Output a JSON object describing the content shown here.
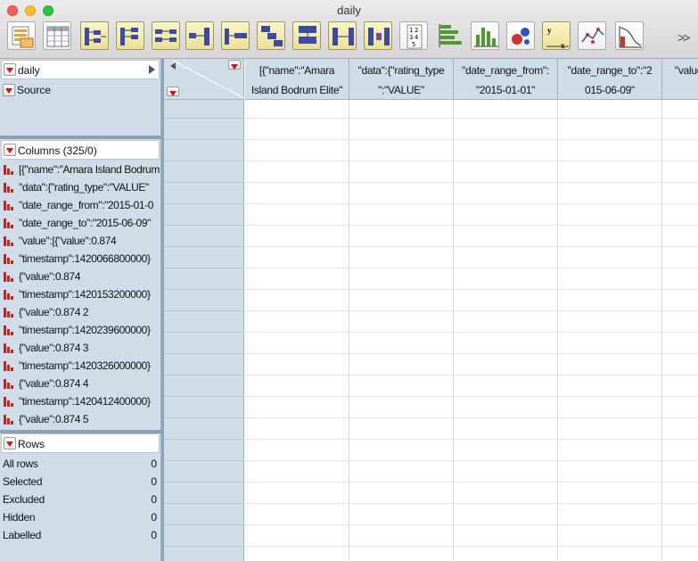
{
  "window": {
    "title": "daily"
  },
  "toolbar": {
    "tools": [
      "data-table-icon",
      "tabulate-icon",
      "summary-icon",
      "subset-icon",
      "sort-icon",
      "stack-icon",
      "split-icon",
      "transpose-icon",
      "concatenate-icon",
      "join-icon",
      "update-icon",
      "column-info-icon",
      "bar-chart-icon",
      "distribution-icon",
      "bubble-plot-icon",
      "fit-y-by-x-icon",
      "graph-builder-icon",
      "survival-icon"
    ],
    "more_label": ">>"
  },
  "tables_panel": {
    "table_name": "daily",
    "source_label": "Source"
  },
  "columns_panel": {
    "header": "Columns (325/0)",
    "items": [
      "[{\"name\":\"Amara Island Bodrum",
      "\"data\":{\"rating_type\":\"VALUE\"",
      "\"date_range_from\":\"2015-01-0",
      "\"date_range_to\":\"2015-06-09\"",
      "\"value\":[{\"value\":0.874",
      "\"timestamp\":1420066800000}",
      "{\"value\":0.874",
      "\"timestamp\":1420153200000}",
      "{\"value\":0.874 2",
      "\"timestamp\":1420239600000}",
      "{\"value\":0.874 3",
      "\"timestamp\":1420326000000}",
      "{\"value\":0.874 4",
      "\"timestamp\":1420412400000}",
      "{\"value\":0.874 5"
    ]
  },
  "rows_panel": {
    "header": "Rows",
    "stats": [
      {
        "label": "All rows",
        "value": "0"
      },
      {
        "label": "Selected",
        "value": "0"
      },
      {
        "label": "Excluded",
        "value": "0"
      },
      {
        "label": "Hidden",
        "value": "0"
      },
      {
        "label": "Labelled",
        "value": "0"
      }
    ]
  },
  "grid": {
    "columns": [
      {
        "line1": "[{\"name\":\"Amara",
        "line2": "Island Bodrum Elite\""
      },
      {
        "line1": "\"data\":{\"rating_type",
        "line2": "\":\"VALUE\""
      },
      {
        "line1": "\"date_range_from\":",
        "line2": "\"2015-01-01\""
      },
      {
        "line1": "\"date_range_to\":\"2",
        "line2": "015-06-09\""
      },
      {
        "line1": "\"value",
        "line2": ""
      }
    ]
  },
  "colors": {
    "panel_bg": "#cfdde8",
    "accent_red": "#d0141a",
    "column_icon": "#c2261c"
  }
}
